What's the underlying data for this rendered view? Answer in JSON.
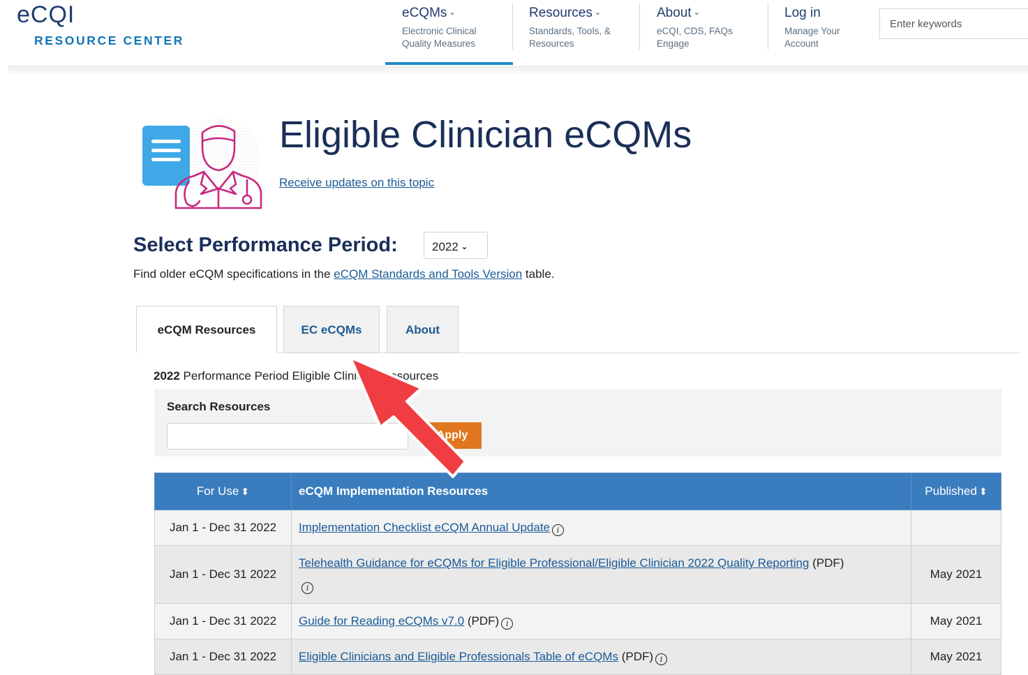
{
  "header": {
    "logo_main": "eCQI",
    "logo_sub": "RESOURCE CENTER",
    "nav": [
      {
        "title": "eCQMs",
        "sub": "Electronic Clinical Quality Measures"
      },
      {
        "title": "Resources",
        "sub": "Standards, Tools, & Resources"
      },
      {
        "title": "About",
        "sub": "eCQI, CDS, FAQs Engage"
      },
      {
        "title": "Log in",
        "sub": "Manage Your Account"
      }
    ],
    "search_placeholder": "Enter keywords"
  },
  "page": {
    "title": "Eligible Clinician eCQMs",
    "updates_link": "Receive updates on this topic",
    "period_label": "Select Performance Period:",
    "period_value": "2022",
    "older_prefix": "Find older eCQM specifications in the ",
    "older_link": "eCQM Standards and Tools Version",
    "older_suffix": " table."
  },
  "tabs": [
    {
      "label": "eCQM Resources",
      "active": true
    },
    {
      "label": "EC eCQMs",
      "active": false
    },
    {
      "label": "About",
      "active": false
    }
  ],
  "resources": {
    "heading_year": "2022",
    "heading_rest": " Performance Period Eligible Clinician Resources",
    "search_label": "Search Resources",
    "apply_label": "Apply"
  },
  "table": {
    "headers": {
      "for_use": "For Use",
      "resources": "eCQM Implementation Resources",
      "published": "Published"
    },
    "rows": [
      {
        "for_use": "Jan 1 - Dec 31 2022",
        "link": "Implementation Checklist eCQM Annual Update",
        "suffix": "",
        "published": ""
      },
      {
        "for_use": "Jan 1 - Dec 31 2022",
        "link": "Telehealth Guidance for eCQMs for Eligible Professional/Eligible Clinician 2022 Quality Reporting",
        "suffix": " (PDF)",
        "published": "May 2021"
      },
      {
        "for_use": "Jan 1 - Dec 31 2022",
        "link": "Guide for Reading eCQMs v7.0",
        "suffix": " (PDF)",
        "published": "May 2021"
      },
      {
        "for_use": "Jan 1 - Dec 31 2022",
        "link": "Eligible Clinicians and Eligible Professionals Table of eCQMs",
        "suffix": " (PDF)",
        "published": "May 2021"
      }
    ]
  },
  "colors": {
    "accent": "#1e8ac8",
    "title": "#1a2f58",
    "table_header": "#3a7dbe",
    "apply": "#e0761e",
    "arrow": "#ef3d42"
  }
}
